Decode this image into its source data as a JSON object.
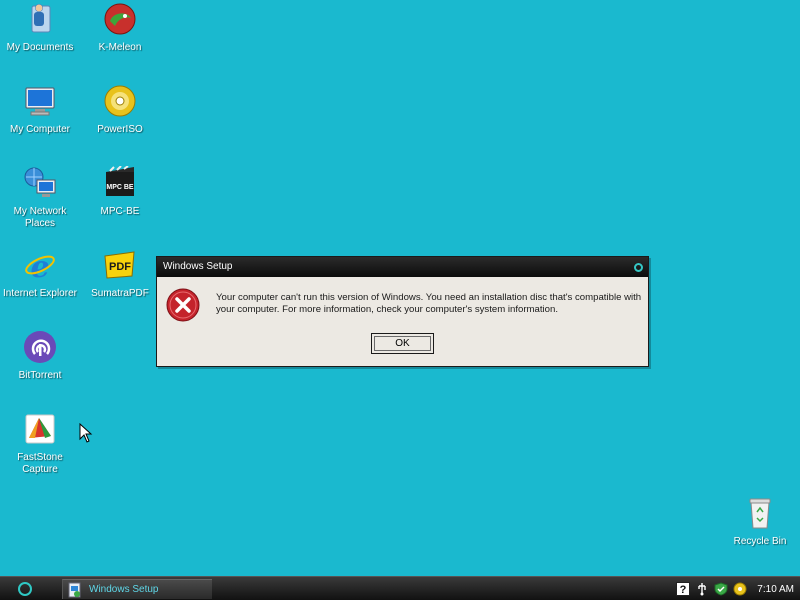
{
  "desktop": {
    "icons": [
      {
        "label": "My Documents",
        "icon": "my-documents-icon"
      },
      {
        "label": "K-Meleon",
        "icon": "k-meleon-icon"
      },
      {
        "label": "My Computer",
        "icon": "my-computer-icon"
      },
      {
        "label": "PowerISO",
        "icon": "poweriso-icon"
      },
      {
        "label": "My Network Places",
        "icon": "network-places-icon"
      },
      {
        "label": "MPC-BE",
        "icon": "mpc-be-icon",
        "badge": "MPC BE"
      },
      {
        "label": "Internet Explorer",
        "icon": "internet-explorer-icon"
      },
      {
        "label": "SumatraPDF",
        "icon": "sumatrapdf-icon",
        "badge": "PDF"
      },
      {
        "label": "BitTorrent",
        "icon": "bittorrent-icon"
      },
      {
        "label": "FastStone Capture",
        "icon": "faststone-capture-icon"
      },
      {
        "label": "Recycle Bin",
        "icon": "recycle-bin-icon"
      }
    ]
  },
  "dialog": {
    "title": "Windows Setup",
    "message": "Your computer can't run this version of Windows. You need an installation disc that's compatible with your computer. For more information, check your computer's system information.",
    "ok_label": "OK",
    "icon": "error-icon"
  },
  "taskbar": {
    "task_label": "Windows Setup",
    "clock": "7:10 AM"
  },
  "colors": {
    "desktop": "#1ab9cf",
    "accent": "#2fc8c4",
    "error": "#c4232b"
  }
}
